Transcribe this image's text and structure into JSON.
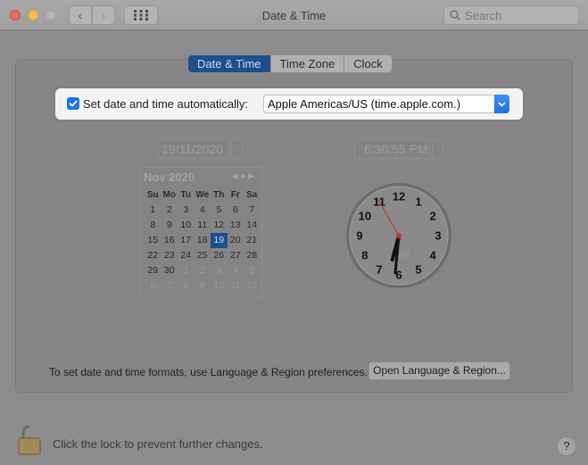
{
  "window": {
    "title": "Date & Time"
  },
  "toolbar": {
    "search_placeholder": "Search"
  },
  "tabs": [
    {
      "label": "Date & Time",
      "selected": true
    },
    {
      "label": "Time Zone",
      "selected": false
    },
    {
      "label": "Clock",
      "selected": false
    }
  ],
  "auto_time": {
    "label": "Set date and time automatically:",
    "checked": true,
    "server": "Apple Americas/US (time.apple.com.)"
  },
  "date_field": {
    "value": "19/11/2020"
  },
  "time_field": {
    "value": "6:30:55 PM"
  },
  "calendar": {
    "month_label": "Nov 2020",
    "day_headers": [
      "Su",
      "Mo",
      "Tu",
      "We",
      "Th",
      "Fr",
      "Sa"
    ],
    "weeks": [
      [
        "1",
        "2",
        "3",
        "4",
        "5",
        "6",
        "7"
      ],
      [
        "8",
        "9",
        "10",
        "11",
        "12",
        "13",
        "14"
      ],
      [
        "15",
        "16",
        "17",
        "18",
        "19",
        "20",
        "21"
      ],
      [
        "22",
        "23",
        "24",
        "25",
        "26",
        "27",
        "28"
      ],
      [
        "29",
        "30",
        "1",
        "2",
        "3",
        "4",
        "5"
      ],
      [
        "6",
        "7",
        "8",
        "9",
        "10",
        "11",
        "12"
      ]
    ],
    "selected_day": "19"
  },
  "clock": {
    "numerals": [
      "12",
      "1",
      "2",
      "3",
      "4",
      "5",
      "6",
      "7",
      "8",
      "9",
      "10",
      "11"
    ],
    "ampm": "PM",
    "hour": 6,
    "minute": 30,
    "second": 55
  },
  "footer": {
    "formats_text": "To set date and time formats, use Language & Region preferences.",
    "formats_button": "Open Language & Region...",
    "lock_text": "Click the lock to prevent further changes.",
    "help_label": "?"
  },
  "colors": {
    "accent": "#1d4e8e",
    "checkbox": "#1a73e8",
    "second_hand": "#c0392b"
  }
}
